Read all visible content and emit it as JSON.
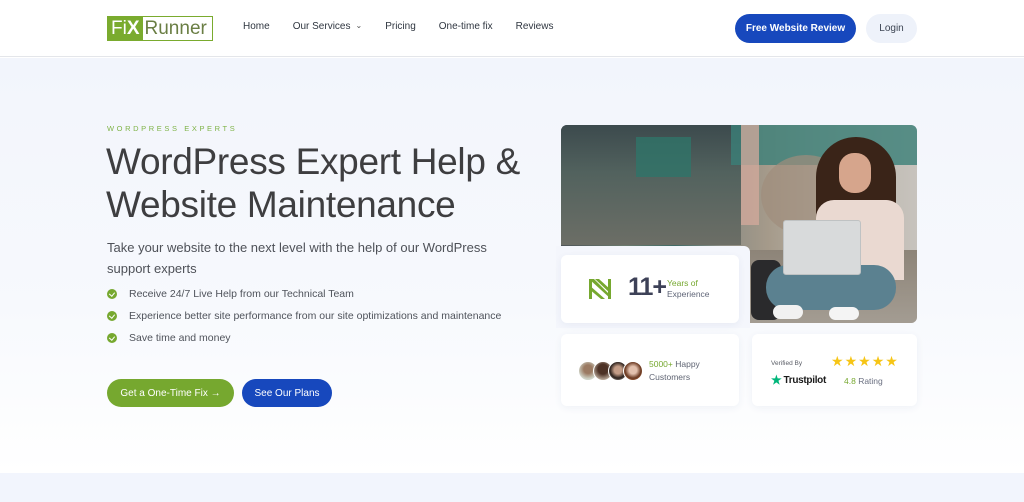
{
  "header": {
    "logo": {
      "part1": "Fi",
      "x": "X",
      "part2": "Runner"
    },
    "nav": [
      {
        "label": "Home"
      },
      {
        "label": "Our Services",
        "has_dropdown": true
      },
      {
        "label": "Pricing"
      },
      {
        "label": "One-time fix"
      },
      {
        "label": "Reviews"
      }
    ],
    "cta_label": "Free Website Review",
    "login_label": "Login"
  },
  "hero": {
    "eyebrow": "WORDPRESS EXPERTS",
    "title": "WordPress Expert Help & Website Maintenance",
    "subtitle": "Take your website to the next level with the help of our WordPress support experts",
    "features": [
      "Receive 24/7 Live Help from our Technical Team",
      "Experience better site performance from our site optimizations and maintenance",
      "Save time and money"
    ],
    "primary_button": "Get a One-Time Fix →",
    "secondary_button": "See Our Plans"
  },
  "stats": {
    "experience": {
      "number": "11+",
      "line1": "Years of",
      "line2": "Experience"
    },
    "customers": {
      "highlight": "5000+",
      "line1_rest": " Happy",
      "line2": "Customers"
    },
    "trust": {
      "verified_label": "Verified By",
      "brand": "Trustpilot",
      "stars": 5,
      "rating_value": "4.8",
      "rating_label": " Rating"
    }
  },
  "colors": {
    "brand_green": "#76a82f",
    "brand_blue": "#1748bd",
    "star_yellow": "#f6c516",
    "trustpilot_green": "#00b67a"
  }
}
